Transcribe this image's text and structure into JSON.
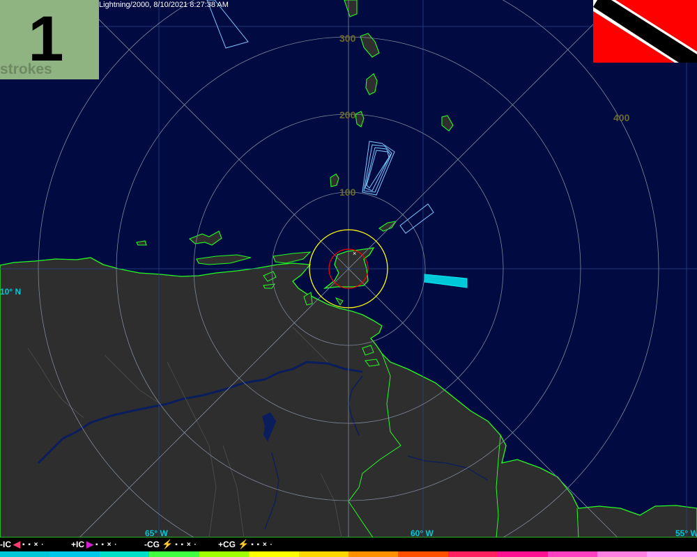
{
  "header": {
    "title": "Lightning/2000, 8/10/2021 8:27:38 AM"
  },
  "counter": {
    "value": "1",
    "unit": "strokes"
  },
  "range_rings": {
    "labels": [
      "100",
      "200",
      "300",
      "400"
    ]
  },
  "coordinates": {
    "lat_label": "10° N",
    "lon_labels": [
      "65° W",
      "60° W",
      "55° W"
    ]
  },
  "legend": {
    "items": [
      {
        "label": "-IC",
        "glyph": "◀",
        "glyph_color": "#ff3c6e",
        "dots": "▪ ▪ × ·"
      },
      {
        "label": "+IC",
        "glyph": "▶",
        "glyph_color": "#d01ed0",
        "dots": "▪ ▪ × ·"
      },
      {
        "label": "-CG",
        "glyph": "⚡",
        "glyph_color": "#ffff00",
        "dots": "▪ ▪ × ·"
      },
      {
        "label": "+CG",
        "glyph": "⚡",
        "glyph_color": "#ffff00",
        "dots": "▪ ▪ × ·"
      }
    ]
  },
  "color_ramp": [
    "#00c8d8",
    "#00c8e8",
    "#00e0c8",
    "#40ff40",
    "#a0ff00",
    "#ffff00",
    "#ffd700",
    "#ff9000",
    "#ff5000",
    "#ff2060",
    "#ff1090",
    "#ff40c0",
    "#ff80e0",
    "#ffa0ff"
  ],
  "colors": {
    "ocean": "#020a42",
    "land": "#2e2e2e",
    "coast": "#22ff22",
    "ring": "#7f8a9c",
    "near_ring": "#ffff00",
    "close_ring": "#ff0000",
    "grid": "#27458a",
    "storm_outline": "#7ecbff",
    "storm_fill": "#00c8d8"
  }
}
